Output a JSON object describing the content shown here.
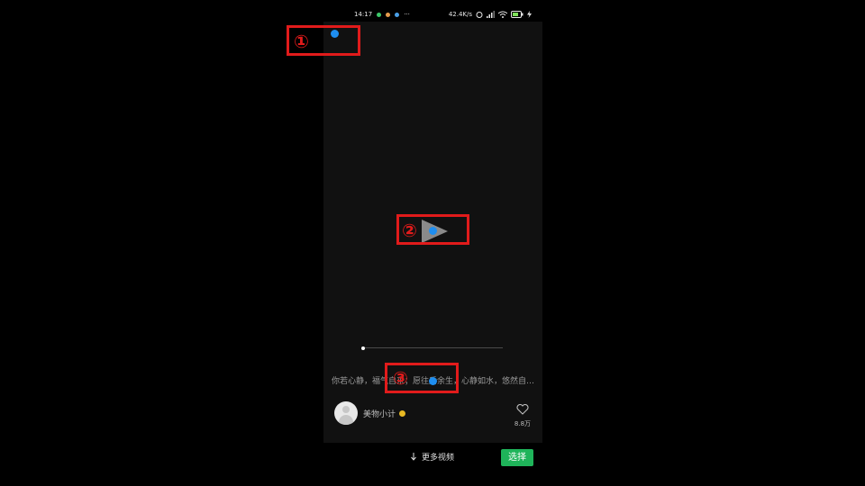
{
  "status_bar": {
    "time": "14:17",
    "more": "···",
    "net_speed": "42.4K/s",
    "app_dot_colors": [
      "#3cc86a",
      "#e79c4d",
      "#4aa0e8"
    ],
    "battery_color": "#7ee05a"
  },
  "video": {
    "caption": "你若心静，福气自来；愿往后余生，心静如水，悠然自…",
    "author": "美物小计",
    "likes": "8.8万"
  },
  "bottom_bar": {
    "more_videos": "更多视频",
    "select": "选择"
  },
  "annotations": [
    {
      "label": "①"
    },
    {
      "label": "②"
    },
    {
      "label": "③"
    }
  ],
  "colors": {
    "accent_green": "#1fb45a",
    "annotation_red": "#e11b1b",
    "marker_blue": "#1e8ef0"
  }
}
